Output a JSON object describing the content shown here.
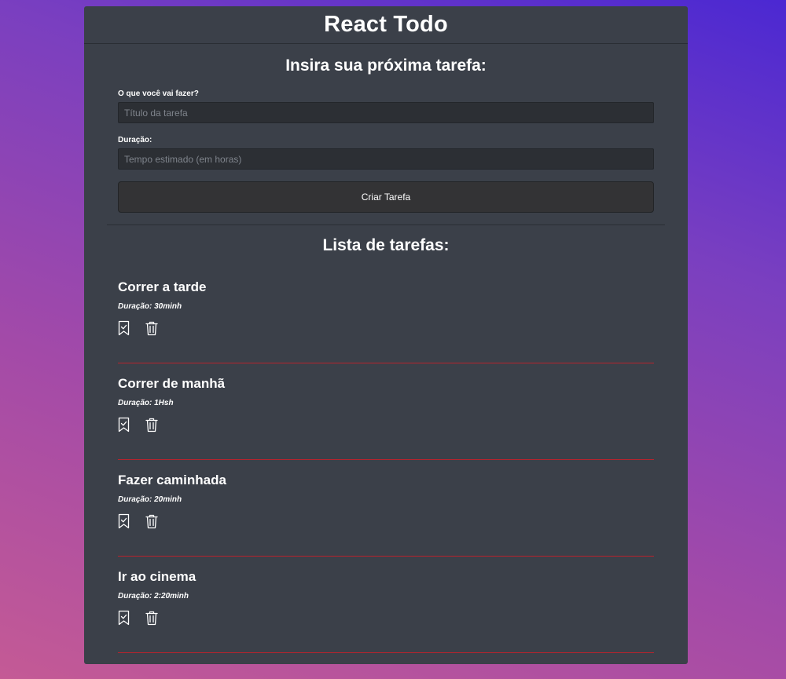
{
  "header": {
    "title": "React Todo"
  },
  "form": {
    "heading": "Insira sua próxima tarefa:",
    "title_label": "O que você vai fazer?",
    "title_placeholder": "Título da tarefa",
    "title_value": "",
    "duration_label": "Duração:",
    "duration_placeholder": "Tempo estimado (em horas)",
    "duration_value": "",
    "submit_label": "Criar Tarefa"
  },
  "list": {
    "heading": "Lista de tarefas:",
    "tasks": [
      {
        "title": "Correr a tarde",
        "duration": "Duração: 30minh"
      },
      {
        "title": "Correr de manhã",
        "duration": "Duração: 1Hsh"
      },
      {
        "title": "Fazer caminhada",
        "duration": "Duração: 20minh"
      },
      {
        "title": "Ir ao cinema",
        "duration": "Duração: 2:20minh"
      }
    ],
    "icons": {
      "done": "bookmark-check-icon",
      "delete": "trash-icon"
    }
  },
  "colors": {
    "panel": "#3b4049",
    "input_bg": "#2c2f34",
    "button_bg": "#333335",
    "task_divider": "#b8232d"
  }
}
